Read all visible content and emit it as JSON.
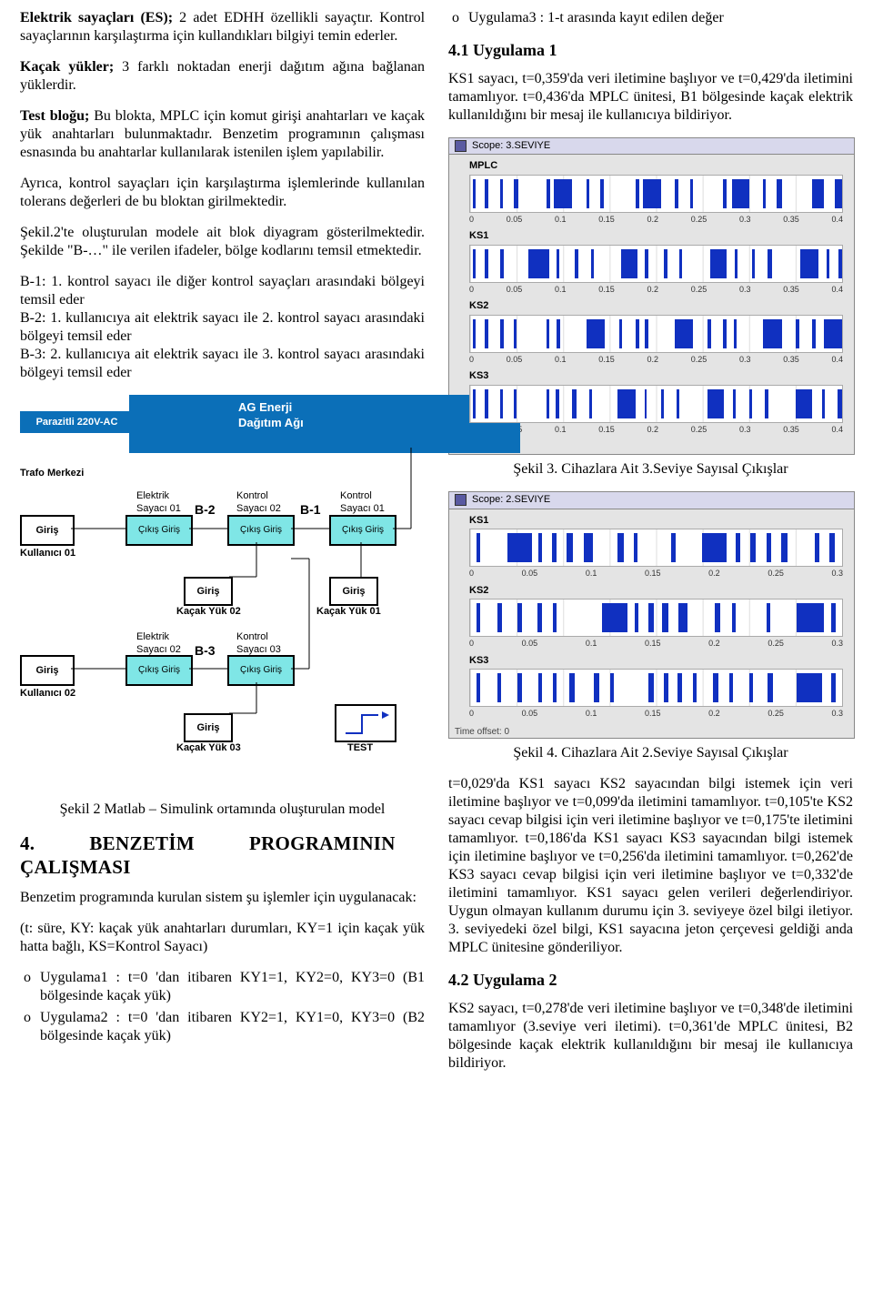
{
  "left": {
    "p1_lead": "Elektrik sayaçları (ES);",
    "p1_rest": " 2 adet EDHH özellikli sayaçtır. Kontrol sayaçlarının karşılaştırma için kullandıkları bilgiyi temin ederler.",
    "p2_lead": "Kaçak yükler;",
    "p2_rest": " 3 farklı noktadan enerji dağıtım ağına bağlanan yüklerdir.",
    "p3_lead": "Test bloğu;",
    "p3_rest": " Bu blokta, MPLC için komut girişi anahtarları ve kaçak yük anahtarları bulunmaktadır. Benzetim programının çalışması esnasında bu anahtarlar kullanılarak istenilen işlem yapılabilir.",
    "p4": "Ayrıca, kontrol sayaçları için karşılaştırma işlemlerinde kullanılan tolerans değerleri de bu bloktan girilmektedir.",
    "p5": "Şekil.2'te oluşturulan modele ait blok diyagram gösterilmektedir. Şekilde \"B-…\" ile verilen ifadeler, bölge kodlarını temsil etmektedir.",
    "p6": "B-1: 1. kontrol sayacı ile diğer kontrol sayaçları arasındaki bölgeyi temsil eder",
    "p7": "B-2: 1. kullanıcıya ait elektrik sayacı ile 2. kontrol sayacı arasındaki bölgeyi temsil eder",
    "p8": "B-3: 2. kullanıcıya ait elektrik sayacı ile 3. kontrol sayacı arasındaki bölgeyi temsil eder",
    "diagram": {
      "banner1": "AG Enerji",
      "banner2": "Dağıtım Ağı",
      "parazitli": "Parazitli  220V-AC",
      "trafo": "Trafo Merkezi",
      "b1": "B-1",
      "b2": "B-2",
      "b3": "B-3",
      "es01": "Elektrik\nSayacı 01",
      "ks02": "Kontrol\nSayacı 02",
      "ks01": "Kontrol\nSayacı 01",
      "es02": "Elektrik\nSayacı 02",
      "ks03": "Kontrol\nSayacı 03",
      "user01": "Kullanıcı 01",
      "user02": "Kullanıcı 02",
      "ky01": "Kaçak Yük 01",
      "ky02": "Kaçak Yük 02",
      "ky03": "Kaçak Yük 03",
      "test": "TEST",
      "giris": "Giriş",
      "cikgir": "Çıkış Giriş"
    },
    "cap2": "Şekil 2 Matlab – Simulink ortamında oluşturulan model",
    "h3a": "4.",
    "h3b": "BENZETİM",
    "h3c": "PROGRAMININ",
    "h3d": "ÇALIŞMASI",
    "p9": "Benzetim programında kurulan sistem şu işlemler için uygulanacak:",
    "p10": "(t: süre, KY: kaçak yük anahtarları durumları, KY=1 için kaçak yük hatta bağlı, KS=Kontrol Sayacı)",
    "li1": "Uygulama1 : t=0 'dan itibaren KY1=1, KY2=0, KY3=0 (B1 bölgesinde kaçak yük)",
    "li2": "Uygulama2 : t=0 'dan itibaren KY2=1, KY1=0, KY3=0 (B2 bölgesinde kaçak yük)"
  },
  "right": {
    "li3": "Uygulama3 : 1-t arasında kayıt edilen değer",
    "h41": "4.1 Uygulama 1",
    "p41": "KS1 sayacı, t=0,359'da veri iletimine başlıyor ve t=0,429'da iletimini tamamlıyor. t=0,436'da MPLC ünitesi, B1 bölgesinde kaçak elektrik kullanıldığını bir mesaj ile kullanıcıya bildiriyor.",
    "scope3_title": "Scope: 3.SEVIYE",
    "scope2_title": "Scope: 2.SEVIYE",
    "timeoff": "Time offset: 0",
    "cap3": "Şekil 3. Cihazlara Ait 3.Seviye Sayısal Çıkışlar",
    "cap4": "Şekil 4. Cihazlara Ait 2.Seviye Sayısal Çıkışlar",
    "p_after4": "t=0,029'da KS1 sayacı KS2 sayacından bilgi istemek için veri iletimine başlıyor ve t=0,099'da iletimini tamamlıyor. t=0,105'te KS2 sayacı cevap bilgisi için veri iletimine başlıyor ve t=0,175'te iletimini tamamlıyor. t=0,186'da KS1 sayacı KS3 sayacından bilgi istemek için iletimine başlıyor ve t=0,256'da iletimini tamamlıyor. t=0,262'de KS3 sayacı cevap bilgisi için veri iletimine başlıyor ve t=0,332'de iletimini tamamlıyor. KS1 sayacı gelen verileri değerlendiriyor. Uygun olmayan kullanım durumu için 3. seviyeye özel bilgi iletiyor. 3. seviyedeki özel bilgi, KS1 sayacına jeton çerçevesi geldiği anda MPLC ünitesine gönderiliyor.",
    "h42": "4.2 Uygulama 2",
    "p42": "KS2 sayacı, t=0,278'de veri iletimine başlıyor ve t=0,348'de iletimini tamamlıyor (3.seviye veri iletimi). t=0,361'de MPLC ünitesi, B2 bölgesinde kaçak elektrik kullanıldığını bir mesaj ile kullanıcıya bildiriyor."
  },
  "chart_data": [
    {
      "type": "line",
      "title": "Scope: 3.SEVIYE — digital outputs (MPLC, KS1, KS2, KS3)",
      "xlabel": "",
      "ylabel": "",
      "xlim": [
        0,
        0.4
      ],
      "ylim": [
        0,
        1
      ],
      "x_ticks": [
        0,
        0.05,
        0.1,
        0.15,
        0.2,
        0.25,
        0.3,
        0.35,
        0.4
      ],
      "series_notes": "Each series is a 0/1 digital waveform. High segments listed as [start,end] in seconds.",
      "series": [
        {
          "name": "MPLC",
          "high_segments": [
            [
              0.003,
              0.006
            ],
            [
              0.016,
              0.02
            ],
            [
              0.032,
              0.035
            ],
            [
              0.047,
              0.052
            ],
            [
              0.082,
              0.086
            ],
            [
              0.09,
              0.11
            ],
            [
              0.125,
              0.128
            ],
            [
              0.14,
              0.144
            ],
            [
              0.178,
              0.182
            ],
            [
              0.186,
              0.205
            ],
            [
              0.22,
              0.224
            ],
            [
              0.237,
              0.24
            ],
            [
              0.272,
              0.276
            ],
            [
              0.282,
              0.3
            ],
            [
              0.315,
              0.318
            ],
            [
              0.33,
              0.335
            ],
            [
              0.368,
              0.38
            ],
            [
              0.392,
              0.4
            ]
          ]
        },
        {
          "name": "KS1",
          "high_segments": [
            [
              0.003,
              0.006
            ],
            [
              0.016,
              0.02
            ],
            [
              0.032,
              0.036
            ],
            [
              0.063,
              0.085
            ],
            [
              0.093,
              0.096
            ],
            [
              0.112,
              0.116
            ],
            [
              0.13,
              0.133
            ],
            [
              0.162,
              0.18
            ],
            [
              0.188,
              0.192
            ],
            [
              0.208,
              0.212
            ],
            [
              0.225,
              0.228
            ],
            [
              0.258,
              0.276
            ],
            [
              0.285,
              0.288
            ],
            [
              0.303,
              0.306
            ],
            [
              0.32,
              0.325
            ],
            [
              0.355,
              0.375
            ],
            [
              0.383,
              0.386
            ],
            [
              0.396,
              0.4
            ]
          ]
        },
        {
          "name": "KS2",
          "high_segments": [
            [
              0.003,
              0.006
            ],
            [
              0.016,
              0.02
            ],
            [
              0.032,
              0.036
            ],
            [
              0.047,
              0.05
            ],
            [
              0.082,
              0.085
            ],
            [
              0.093,
              0.097
            ],
            [
              0.125,
              0.145
            ],
            [
              0.16,
              0.163
            ],
            [
              0.178,
              0.182
            ],
            [
              0.188,
              0.192
            ],
            [
              0.22,
              0.24
            ],
            [
              0.255,
              0.259
            ],
            [
              0.272,
              0.276
            ],
            [
              0.284,
              0.287
            ],
            [
              0.315,
              0.335
            ],
            [
              0.35,
              0.354
            ],
            [
              0.368,
              0.372
            ],
            [
              0.38,
              0.4
            ]
          ]
        },
        {
          "name": "KS3",
          "high_segments": [
            [
              0.003,
              0.006
            ],
            [
              0.016,
              0.02
            ],
            [
              0.032,
              0.035
            ],
            [
              0.047,
              0.05
            ],
            [
              0.082,
              0.085
            ],
            [
              0.092,
              0.096
            ],
            [
              0.11,
              0.114
            ],
            [
              0.128,
              0.131
            ],
            [
              0.158,
              0.178
            ],
            [
              0.188,
              0.19
            ],
            [
              0.205,
              0.208
            ],
            [
              0.222,
              0.225
            ],
            [
              0.255,
              0.273
            ],
            [
              0.283,
              0.286
            ],
            [
              0.3,
              0.303
            ],
            [
              0.317,
              0.321
            ],
            [
              0.35,
              0.368
            ],
            [
              0.378,
              0.381
            ],
            [
              0.395,
              0.4
            ]
          ]
        }
      ]
    },
    {
      "type": "line",
      "title": "Scope: 2.SEVIYE — digital outputs (KS1, KS2, KS3)",
      "xlabel": "",
      "ylabel": "",
      "xlim": [
        0,
        0.3
      ],
      "ylim": [
        0,
        1
      ],
      "x_ticks": [
        0,
        0.05,
        0.1,
        0.15,
        0.2,
        0.25,
        0.3
      ],
      "series_notes": "Each series is a 0/1 digital waveform. High segments listed as [start,end] in seconds.",
      "series": [
        {
          "name": "KS1",
          "high_segments": [
            [
              0.005,
              0.008
            ],
            [
              0.03,
              0.05
            ],
            [
              0.055,
              0.058
            ],
            [
              0.066,
              0.07
            ],
            [
              0.078,
              0.083
            ],
            [
              0.092,
              0.099
            ],
            [
              0.119,
              0.124
            ],
            [
              0.132,
              0.135
            ],
            [
              0.162,
              0.166
            ],
            [
              0.187,
              0.207
            ],
            [
              0.214,
              0.218
            ],
            [
              0.226,
              0.23
            ],
            [
              0.239,
              0.243
            ],
            [
              0.251,
              0.256
            ],
            [
              0.278,
              0.282
            ],
            [
              0.29,
              0.294
            ]
          ]
        },
        {
          "name": "KS2",
          "high_segments": [
            [
              0.005,
              0.008
            ],
            [
              0.022,
              0.026
            ],
            [
              0.038,
              0.042
            ],
            [
              0.054,
              0.058
            ],
            [
              0.067,
              0.07
            ],
            [
              0.106,
              0.127
            ],
            [
              0.133,
              0.136
            ],
            [
              0.144,
              0.148
            ],
            [
              0.155,
              0.16
            ],
            [
              0.168,
              0.175
            ],
            [
              0.197,
              0.202
            ],
            [
              0.211,
              0.214
            ],
            [
              0.239,
              0.242
            ],
            [
              0.263,
              0.285
            ],
            [
              0.291,
              0.295
            ]
          ]
        },
        {
          "name": "KS3",
          "high_segments": [
            [
              0.005,
              0.008
            ],
            [
              0.022,
              0.025
            ],
            [
              0.038,
              0.042
            ],
            [
              0.055,
              0.058
            ],
            [
              0.067,
              0.07
            ],
            [
              0.08,
              0.084
            ],
            [
              0.1,
              0.104
            ],
            [
              0.113,
              0.116
            ],
            [
              0.144,
              0.148
            ],
            [
              0.156,
              0.16
            ],
            [
              0.167,
              0.171
            ],
            [
              0.18,
              0.183
            ],
            [
              0.196,
              0.2
            ],
            [
              0.209,
              0.212
            ],
            [
              0.225,
              0.228
            ],
            [
              0.24,
              0.244
            ],
            [
              0.263,
              0.284
            ],
            [
              0.291,
              0.295
            ]
          ]
        }
      ]
    }
  ]
}
